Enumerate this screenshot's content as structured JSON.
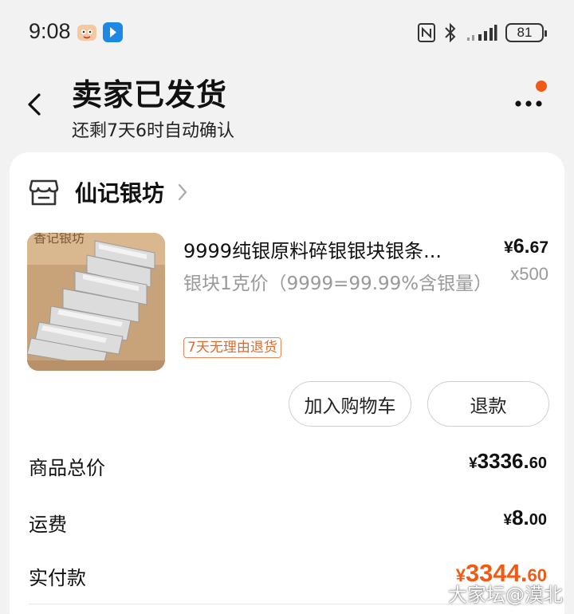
{
  "status_bar": {
    "time": "9:08",
    "battery": "81",
    "icons": [
      "nfc-icon",
      "bluetooth-icon",
      "signal-icon",
      "battery-icon"
    ]
  },
  "header": {
    "title": "卖家已发货",
    "subtitle": "还剩7天6时自动确认",
    "notification_dot_color": "#f05a14"
  },
  "shop": {
    "name": "仙记银坊"
  },
  "product": {
    "title": "9999纯银原料碎银银块银条...",
    "spec": "银块1克价（9999=99.99%含银量）",
    "price_symbol": "¥",
    "price_int": "6.",
    "price_dec": "67",
    "quantity": "x500",
    "tag": "7天无理由退货"
  },
  "actions": {
    "add_to_cart": "加入购物车",
    "refund": "退款"
  },
  "summary": {
    "goods_total_label": "商品总价",
    "goods_total_symbol": "¥",
    "goods_total_int": "3336.",
    "goods_total_dec": "60",
    "shipping_label": "运费",
    "shipping_symbol": "¥",
    "shipping_int": "8.",
    "shipping_dec": "00",
    "paid_label": "实付款",
    "paid_symbol": "¥",
    "paid_int": "3344.",
    "paid_dec": "60"
  },
  "watermark": "大家坛@漠北",
  "colors": {
    "accent": "#f05a14",
    "background": "#f2f2f2",
    "card": "#ffffff"
  }
}
